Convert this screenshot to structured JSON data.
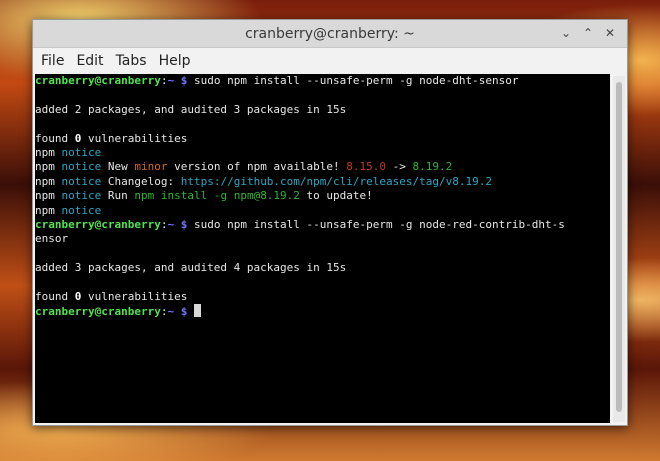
{
  "window": {
    "title": "cranberry@cranberry: ~",
    "controls": {
      "minimize": "⌄",
      "maximize": "⌃",
      "close": "✕"
    }
  },
  "menu": [
    "File",
    "Edit",
    "Tabs",
    "Help"
  ],
  "terminal": {
    "prompt": {
      "user": "cranberry@cranberry",
      "sep": ":",
      "path": "~",
      "symbol": " $"
    },
    "lines": [
      {
        "type": "cmd",
        "text": " sudo npm install --unsafe-perm -g node-dht-sensor"
      },
      {
        "type": "blank"
      },
      {
        "type": "text",
        "text": "added 2 packages, and audited 3 packages in 15s"
      },
      {
        "type": "blank"
      },
      {
        "type": "found",
        "a": "found ",
        "num": "0",
        "b": " vulnerabilities"
      },
      {
        "type": "notice",
        "rest": ""
      },
      {
        "type": "notice_new",
        "a": " New ",
        "minor": "minor",
        "b": " version of npm available! ",
        "old": "8.15.0",
        "arrow": " -> ",
        "new": "8.19.2"
      },
      {
        "type": "notice_changelog",
        "a": " Changelog: ",
        "url": "https://github.com/npm/cli/releases/tag/v8.19.2"
      },
      {
        "type": "notice_run",
        "a": " Run ",
        "cmd": "npm install -g npm@8.19.2",
        "b": " to update!"
      },
      {
        "type": "notice",
        "rest": ""
      },
      {
        "type": "cmd",
        "text": " sudo npm install --unsafe-perm -g node-red-contrib-dht-s"
      },
      {
        "type": "text",
        "text": "ensor"
      },
      {
        "type": "blank"
      },
      {
        "type": "text",
        "text": "added 3 packages, and audited 4 packages in 15s"
      },
      {
        "type": "blank"
      },
      {
        "type": "found",
        "a": "found ",
        "num": "0",
        "b": " vulnerabilities"
      },
      {
        "type": "prompt_cursor"
      }
    ],
    "npm": "npm",
    "notice": " notice"
  },
  "colors": {
    "user": "#55e052",
    "path": "#6e74ff",
    "cyan": "#2aa7c4",
    "orange": "#d06a1c",
    "red": "#c0392b",
    "green": "#2fb62f"
  }
}
